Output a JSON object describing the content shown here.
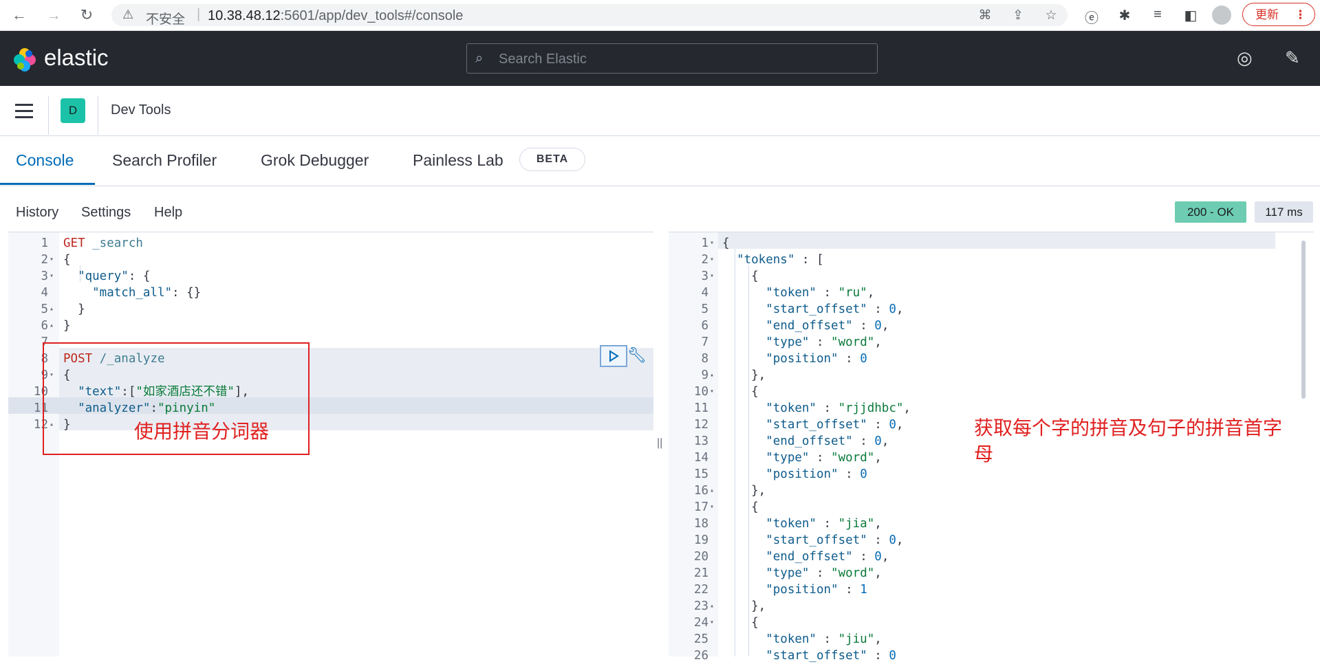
{
  "browser": {
    "security_label": "不安全",
    "url_host": "10.38.48.12",
    "url_port_path": ":5601/app/dev_tools#/console",
    "update_label": "更新"
  },
  "header": {
    "brand": "elastic",
    "search_placeholder": "Search Elastic"
  },
  "appbar": {
    "space_initial": "D",
    "breadcrumb": "Dev Tools"
  },
  "tabs": [
    {
      "label": "Console",
      "active": true
    },
    {
      "label": "Search Profiler",
      "active": false
    },
    {
      "label": "Grok Debugger",
      "active": false
    },
    {
      "label": "Painless Lab",
      "active": false
    }
  ],
  "beta_badge": "BETA",
  "toolbar": {
    "history": "History",
    "settings": "Settings",
    "help": "Help",
    "status": "200 - OK",
    "time": "117 ms"
  },
  "request_lines": [
    {
      "n": "1",
      "fold": "",
      "parts": [
        [
          "GET",
          "m"
        ],
        [
          " _search",
          "u"
        ]
      ]
    },
    {
      "n": "2",
      "fold": "▾",
      "parts": [
        [
          "{",
          "p"
        ]
      ]
    },
    {
      "n": "3",
      "fold": "▾",
      "parts": [
        [
          "  \"query\"",
          "k"
        ],
        [
          ": {",
          "p"
        ]
      ]
    },
    {
      "n": "4",
      "fold": "",
      "parts": [
        [
          "    \"match_all\"",
          "k"
        ],
        [
          ": {}",
          "p"
        ]
      ]
    },
    {
      "n": "5",
      "fold": "▴",
      "parts": [
        [
          "  }",
          "p"
        ]
      ]
    },
    {
      "n": "6",
      "fold": "▴",
      "parts": [
        [
          "}",
          "p"
        ]
      ]
    },
    {
      "n": "7",
      "fold": "",
      "parts": []
    },
    {
      "n": "8",
      "fold": "",
      "parts": [
        [
          "POST",
          "m"
        ],
        [
          " /_analyze",
          "u"
        ]
      ]
    },
    {
      "n": "9",
      "fold": "▾",
      "parts": [
        [
          "{",
          "p"
        ]
      ]
    },
    {
      "n": "10",
      "fold": "",
      "parts": [
        [
          "  \"text\"",
          "k"
        ],
        [
          ":[",
          "p"
        ],
        [
          "\"如家酒店还不错\"",
          "s"
        ],
        [
          "],",
          "p"
        ]
      ]
    },
    {
      "n": "11",
      "fold": "",
      "parts": [
        [
          "  \"analyzer\"",
          "k"
        ],
        [
          ":",
          "p"
        ],
        [
          "\"pinyin\"",
          "s"
        ]
      ]
    },
    {
      "n": "12",
      "fold": "▴",
      "parts": [
        [
          "}",
          "p"
        ]
      ]
    }
  ],
  "response_lines": [
    {
      "n": "1",
      "fold": "▾",
      "parts": [
        [
          "{",
          "p"
        ]
      ]
    },
    {
      "n": "2",
      "fold": "▾",
      "parts": [
        [
          "  \"tokens\"",
          "k"
        ],
        [
          " : [",
          "p"
        ]
      ]
    },
    {
      "n": "3",
      "fold": "▾",
      "parts": [
        [
          "    {",
          "p"
        ]
      ]
    },
    {
      "n": "4",
      "fold": "",
      "parts": [
        [
          "      \"token\"",
          "k"
        ],
        [
          " : ",
          "p"
        ],
        [
          "\"ru\"",
          "s"
        ],
        [
          ",",
          "p"
        ]
      ]
    },
    {
      "n": "5",
      "fold": "",
      "parts": [
        [
          "      \"start_offset\"",
          "k"
        ],
        [
          " : ",
          "p"
        ],
        [
          "0",
          "n"
        ],
        [
          ",",
          "p"
        ]
      ]
    },
    {
      "n": "6",
      "fold": "",
      "parts": [
        [
          "      \"end_offset\"",
          "k"
        ],
        [
          " : ",
          "p"
        ],
        [
          "0",
          "n"
        ],
        [
          ",",
          "p"
        ]
      ]
    },
    {
      "n": "7",
      "fold": "",
      "parts": [
        [
          "      \"type\"",
          "k"
        ],
        [
          " : ",
          "p"
        ],
        [
          "\"word\"",
          "s"
        ],
        [
          ",",
          "p"
        ]
      ]
    },
    {
      "n": "8",
      "fold": "",
      "parts": [
        [
          "      \"position\"",
          "k"
        ],
        [
          " : ",
          "p"
        ],
        [
          "0",
          "n"
        ]
      ]
    },
    {
      "n": "9",
      "fold": "▴",
      "parts": [
        [
          "    },",
          "p"
        ]
      ]
    },
    {
      "n": "10",
      "fold": "▾",
      "parts": [
        [
          "    {",
          "p"
        ]
      ]
    },
    {
      "n": "11",
      "fold": "",
      "parts": [
        [
          "      \"token\"",
          "k"
        ],
        [
          " : ",
          "p"
        ],
        [
          "\"rjjdhbc\"",
          "s"
        ],
        [
          ",",
          "p"
        ]
      ]
    },
    {
      "n": "12",
      "fold": "",
      "parts": [
        [
          "      \"start_offset\"",
          "k"
        ],
        [
          " : ",
          "p"
        ],
        [
          "0",
          "n"
        ],
        [
          ",",
          "p"
        ]
      ]
    },
    {
      "n": "13",
      "fold": "",
      "parts": [
        [
          "      \"end_offset\"",
          "k"
        ],
        [
          " : ",
          "p"
        ],
        [
          "0",
          "n"
        ],
        [
          ",",
          "p"
        ]
      ]
    },
    {
      "n": "14",
      "fold": "",
      "parts": [
        [
          "      \"type\"",
          "k"
        ],
        [
          " : ",
          "p"
        ],
        [
          "\"word\"",
          "s"
        ],
        [
          ",",
          "p"
        ]
      ]
    },
    {
      "n": "15",
      "fold": "",
      "parts": [
        [
          "      \"position\"",
          "k"
        ],
        [
          " : ",
          "p"
        ],
        [
          "0",
          "n"
        ]
      ]
    },
    {
      "n": "16",
      "fold": "▴",
      "parts": [
        [
          "    },",
          "p"
        ]
      ]
    },
    {
      "n": "17",
      "fold": "▾",
      "parts": [
        [
          "    {",
          "p"
        ]
      ]
    },
    {
      "n": "18",
      "fold": "",
      "parts": [
        [
          "      \"token\"",
          "k"
        ],
        [
          " : ",
          "p"
        ],
        [
          "\"jia\"",
          "s"
        ],
        [
          ",",
          "p"
        ]
      ]
    },
    {
      "n": "19",
      "fold": "",
      "parts": [
        [
          "      \"start_offset\"",
          "k"
        ],
        [
          " : ",
          "p"
        ],
        [
          "0",
          "n"
        ],
        [
          ",",
          "p"
        ]
      ]
    },
    {
      "n": "20",
      "fold": "",
      "parts": [
        [
          "      \"end_offset\"",
          "k"
        ],
        [
          " : ",
          "p"
        ],
        [
          "0",
          "n"
        ],
        [
          ",",
          "p"
        ]
      ]
    },
    {
      "n": "21",
      "fold": "",
      "parts": [
        [
          "      \"type\"",
          "k"
        ],
        [
          " : ",
          "p"
        ],
        [
          "\"word\"",
          "s"
        ],
        [
          ",",
          "p"
        ]
      ]
    },
    {
      "n": "22",
      "fold": "",
      "parts": [
        [
          "      \"position\"",
          "k"
        ],
        [
          " : ",
          "p"
        ],
        [
          "1",
          "n"
        ]
      ]
    },
    {
      "n": "23",
      "fold": "▴",
      "parts": [
        [
          "    },",
          "p"
        ]
      ]
    },
    {
      "n": "24",
      "fold": "▾",
      "parts": [
        [
          "    {",
          "p"
        ]
      ]
    },
    {
      "n": "25",
      "fold": "",
      "parts": [
        [
          "      \"token\"",
          "k"
        ],
        [
          " : ",
          "p"
        ],
        [
          "\"jiu\"",
          "s"
        ],
        [
          ",",
          "p"
        ]
      ]
    },
    {
      "n": "26",
      "fold": "",
      "parts": [
        [
          "      \"start_offset\"",
          "k"
        ],
        [
          " : ",
          "p"
        ],
        [
          "0",
          "n"
        ]
      ]
    }
  ],
  "annotations": {
    "left": "使用拼音分词器",
    "right": "获取每个字的拼音及句子的拼音首字母"
  },
  "colors": {
    "accent": "#006bb8",
    "header_bg": "#25282f",
    "status_ok": "#6dccb1",
    "annotation": "#e02020"
  }
}
